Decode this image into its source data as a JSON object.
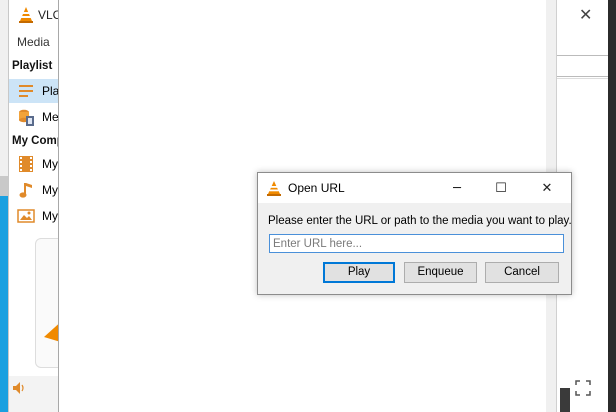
{
  "vlc_window": {
    "title": "VLC",
    "menu": "Media",
    "sections": {
      "playlist_header": "Playlist",
      "computer_header": "My Comp"
    },
    "items": [
      {
        "label": "Play",
        "icon": "playlist-icon",
        "selected": true
      },
      {
        "label": "Me",
        "icon": "media-library-icon",
        "selected": false
      },
      {
        "label": "My",
        "icon": "videos-icon",
        "selected": false
      },
      {
        "label": "My",
        "icon": "music-icon",
        "selected": false
      },
      {
        "label": "My",
        "icon": "pictures-icon",
        "selected": false
      }
    ],
    "volume_icon": "speaker-icon"
  },
  "right_window": {
    "close_icon": "close-icon",
    "fullscreen_icon": "fullscreen-icon"
  },
  "dialog": {
    "title": "Open URL",
    "minimize_icon": "minimize-icon",
    "maximize_icon": "maximize-icon",
    "close_icon": "close-icon",
    "prompt": "Please enter the URL or path to the media you want to play.",
    "input": {
      "value": "",
      "placeholder": "Enter URL here..."
    },
    "buttons": {
      "play": "Play",
      "enqueue": "Enqueue",
      "cancel": "Cancel"
    }
  },
  "colors": {
    "vlc_orange": "#f08a00",
    "selection": "#cce4f7",
    "focus_blue": "#0078d7"
  }
}
